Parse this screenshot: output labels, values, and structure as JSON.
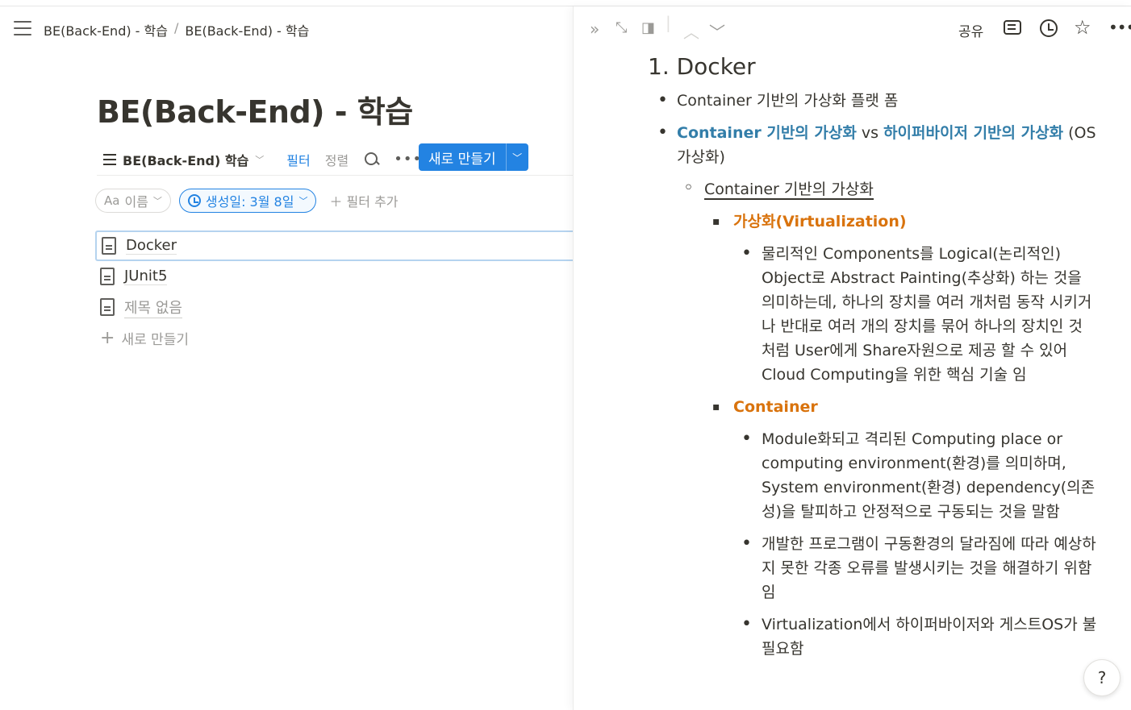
{
  "breadcrumb": [
    "BE(Back-End) - 학습",
    "BE(Back-End) - 학습"
  ],
  "breadcrumb_sep": "/",
  "page_title": "BE(Back-End) - 학습",
  "view": {
    "tab_label": "BE(Back-End) 학습",
    "filter_label": "필터",
    "sort_label": "정렬",
    "more_label": "•••",
    "new_label": "새로 만들기"
  },
  "filters": {
    "name_prefix": "Aa",
    "name_label": "이름",
    "date_chip": "생성일: 3월 8일",
    "add_filter": "필터 추가"
  },
  "rows": [
    "Docker",
    "JUnit5",
    "제목 없음"
  ],
  "new_row_label": "새로 만들기",
  "peek_toolbar": {
    "share_label": "공유",
    "more_label": "•••"
  },
  "doc": {
    "heading": "1. Docker",
    "b1": "Container 기반의 가상화 플랫 폼",
    "b2_link1": "Container 기반의 가상화",
    "b2_vs": " vs ",
    "b2_link2": "하이퍼바이저 기반의 가상화",
    "b2_rest": "(OS가상화)",
    "sub1": "Container 기반의 가상화",
    "virt_title": "가상화(Virtualization)",
    "virt_desc": "물리적인 Components를 Logical(논리적인) Object로 Abstract Painting(추상화) 하는 것을 의미하는데, 하나의 장치를 여러 개처럼 동작 시키거나 반대로 여러 개의 장치를 묶어 하나의 장치인 것 처럼 User에게 Share자원으로 제공 할 수 있어 Cloud Computing을 위한 핵심 기술 임",
    "container_title": "Container",
    "container_desc1": "Module화되고 격리된 Computing place or computing environment(환경)를 의미하며, System environment(환경) dependency(의존성)을 탈피하고 안정적으로 구동되는 것을 말함",
    "container_desc2": "개발한 프로그램이 구동환경의 달라짐에 따라 예상하지 못한 각종 오류를 발생시키는 것을 해결하기 위함임",
    "container_desc3": "Virtualization에서 하이퍼바이저와 게스트OS가 불필요함"
  },
  "help_label": "?"
}
